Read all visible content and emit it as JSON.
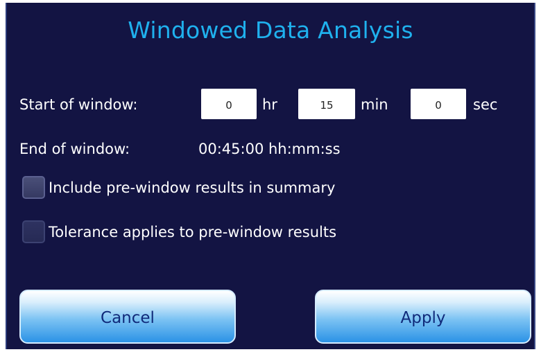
{
  "dialog": {
    "title": "Windowed Data Analysis"
  },
  "start_window": {
    "label": "Start of window:",
    "hours": "0",
    "hours_unit": "hr",
    "minutes": "15",
    "minutes_unit": "min",
    "seconds": "0",
    "seconds_unit": "sec"
  },
  "end_window": {
    "label": "End of window:",
    "value": "00:45:00 hh:mm:ss"
  },
  "options": [
    {
      "label": "Include pre-window results in summary",
      "checked": false
    },
    {
      "label": "Tolerance applies to pre-window results",
      "checked": false
    }
  ],
  "buttons": {
    "cancel": "Cancel",
    "apply": "Apply"
  },
  "colors": {
    "background": "#131443",
    "title": "#1fb1ee",
    "button_text": "#102a7a"
  }
}
